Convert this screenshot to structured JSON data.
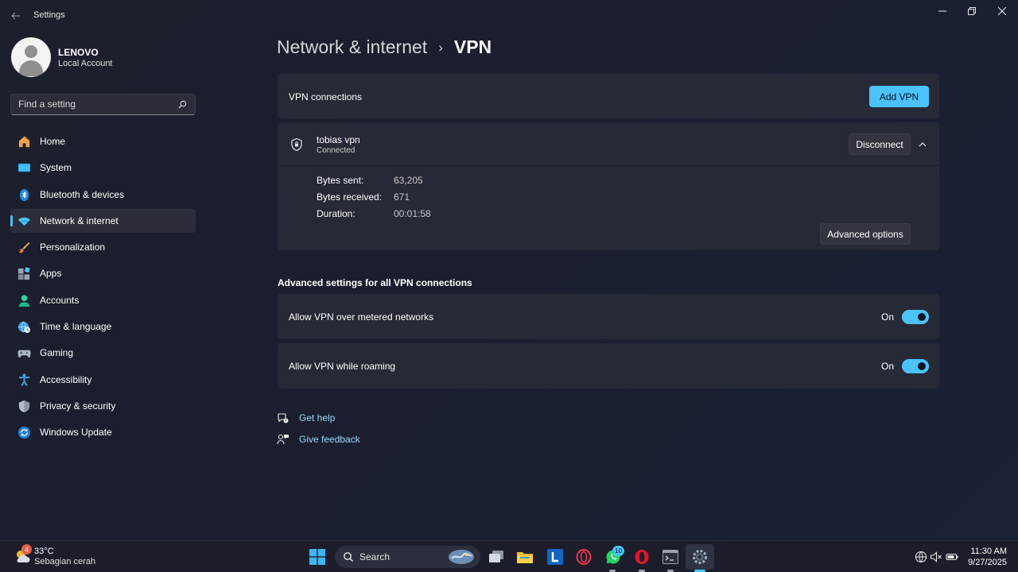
{
  "window": {
    "title": "Settings",
    "controls": {
      "minimize": "—",
      "maximize": "❐",
      "close": "✕"
    }
  },
  "profile": {
    "name": "LENOVO",
    "account_type": "Local Account"
  },
  "search": {
    "placeholder": "Find a setting"
  },
  "nav": {
    "items": [
      {
        "label": "Home",
        "icon": "home-icon"
      },
      {
        "label": "System",
        "icon": "system-icon"
      },
      {
        "label": "Bluetooth & devices",
        "icon": "bluetooth-icon"
      },
      {
        "label": "Network & internet",
        "icon": "network-icon",
        "active": true
      },
      {
        "label": "Personalization",
        "icon": "brush-icon"
      },
      {
        "label": "Apps",
        "icon": "apps-icon"
      },
      {
        "label": "Accounts",
        "icon": "accounts-icon"
      },
      {
        "label": "Time & language",
        "icon": "globe-clock-icon"
      },
      {
        "label": "Gaming",
        "icon": "gamepad-icon"
      },
      {
        "label": "Accessibility",
        "icon": "accessibility-icon"
      },
      {
        "label": "Privacy & security",
        "icon": "shield-icon"
      },
      {
        "label": "Windows Update",
        "icon": "update-icon"
      }
    ]
  },
  "breadcrumb": {
    "parent": "Network & internet",
    "separator": "›",
    "current": "VPN"
  },
  "vpn_connections": {
    "label": "VPN connections",
    "add_button": "Add VPN"
  },
  "connection": {
    "name": "tobias vpn",
    "status": "Connected",
    "disconnect_button": "Disconnect",
    "stats": [
      {
        "label": "Bytes sent:",
        "value": "63,205"
      },
      {
        "label": "Bytes received:",
        "value": "671"
      },
      {
        "label": "Duration:",
        "value": "00:01:58"
      }
    ],
    "advanced_button": "Advanced options"
  },
  "advanced": {
    "title": "Advanced settings for all VPN connections",
    "toggles": [
      {
        "label": "Allow VPN over metered networks",
        "state": "On",
        "on": true
      },
      {
        "label": "Allow VPN while roaming",
        "state": "On",
        "on": true
      }
    ]
  },
  "help": {
    "get_help": "Get help",
    "give_feedback": "Give feedback"
  },
  "taskbar": {
    "weather": {
      "badge": "4",
      "temp": "33°C",
      "desc": "Sebagian cerah"
    },
    "search_label": "Search",
    "whatsapp_badge": "10",
    "clock": {
      "time": "11:30 AM",
      "date": "9/27/2025"
    }
  },
  "colors": {
    "accent": "#4cc2ff",
    "card": "#262936",
    "background": "#1c1f2c"
  }
}
